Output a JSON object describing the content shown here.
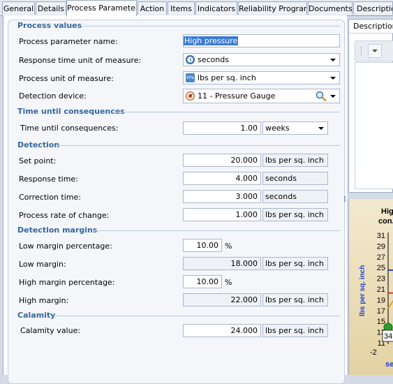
{
  "tabs": [
    "General",
    "Details",
    "Process Parameter",
    "Action",
    "Items",
    "Indicators",
    "Reliability Program",
    "Documents",
    "Description"
  ],
  "active_tab": "Process Parameter",
  "sections": {
    "process_values": "Process values",
    "time_until": "Time until consequences",
    "detection": "Detection",
    "margins": "Detection margins",
    "calamity": "Calamity"
  },
  "form": {
    "param_name_label": "Process parameter name:",
    "param_name_value": "High pressure",
    "resp_unit_label": "Response time unit of measure:",
    "resp_unit_value": "seconds",
    "proc_unit_label": "Process unit of measure:",
    "proc_unit_value": "lbs per sq. inch",
    "proc_unit_icon_text": "kPa",
    "det_device_label": "Detection device:",
    "det_device_value": "11 - Pressure Gauge",
    "time_label": "Time until consequences:",
    "time_value": "1.00",
    "time_unit": "weeks",
    "set_point_label": "Set point:",
    "set_point_value": "20.000",
    "set_point_unit": "lbs per sq. inch",
    "response_label": "Response time:",
    "response_value": "4.000",
    "response_unit": "seconds",
    "correction_label": "Correction time:",
    "correction_value": "3.000",
    "correction_unit": "seconds",
    "rate_label": "Process rate of change:",
    "rate_value": "1.000",
    "rate_unit": "lbs per sq. inch",
    "low_pct_label": "Low margin percentage:",
    "low_pct_value": "10.00",
    "low_pct_sym": "%",
    "low_margin_label": "Low margin:",
    "low_margin_value": "18.000",
    "low_margin_unit": "lbs per sq. inch",
    "high_pct_label": "High margin percentage:",
    "high_pct_value": "10.00",
    "high_pct_sym": "%",
    "high_margin_label": "High margin:",
    "high_margin_value": "22.000",
    "high_margin_unit": "lbs per sq. inch",
    "calamity_label": "Calamity value:",
    "calamity_value": "24.000",
    "calamity_unit": "lbs per sq. inch"
  },
  "description_panel": {
    "tab": "Description"
  },
  "chart_data": {
    "type": "line",
    "title": "Hig... con...",
    "ylabel": "lbs per sq. inch",
    "xlabel": "se...",
    "y_ticks": [
      "31",
      "29",
      "27",
      "25",
      "23",
      "21",
      "19",
      "17",
      "15",
      "13",
      "11"
    ],
    "x_ticks": [
      "-2"
    ],
    "point_label": "34",
    "lines": {
      "calamity": 24,
      "high_margin": 22,
      "set_point": 20
    },
    "colors": {
      "blue_line": "#1f3fd6",
      "red_line": "#d43a22",
      "orange_line": "#f0a020",
      "green_point": "#28a028"
    }
  }
}
